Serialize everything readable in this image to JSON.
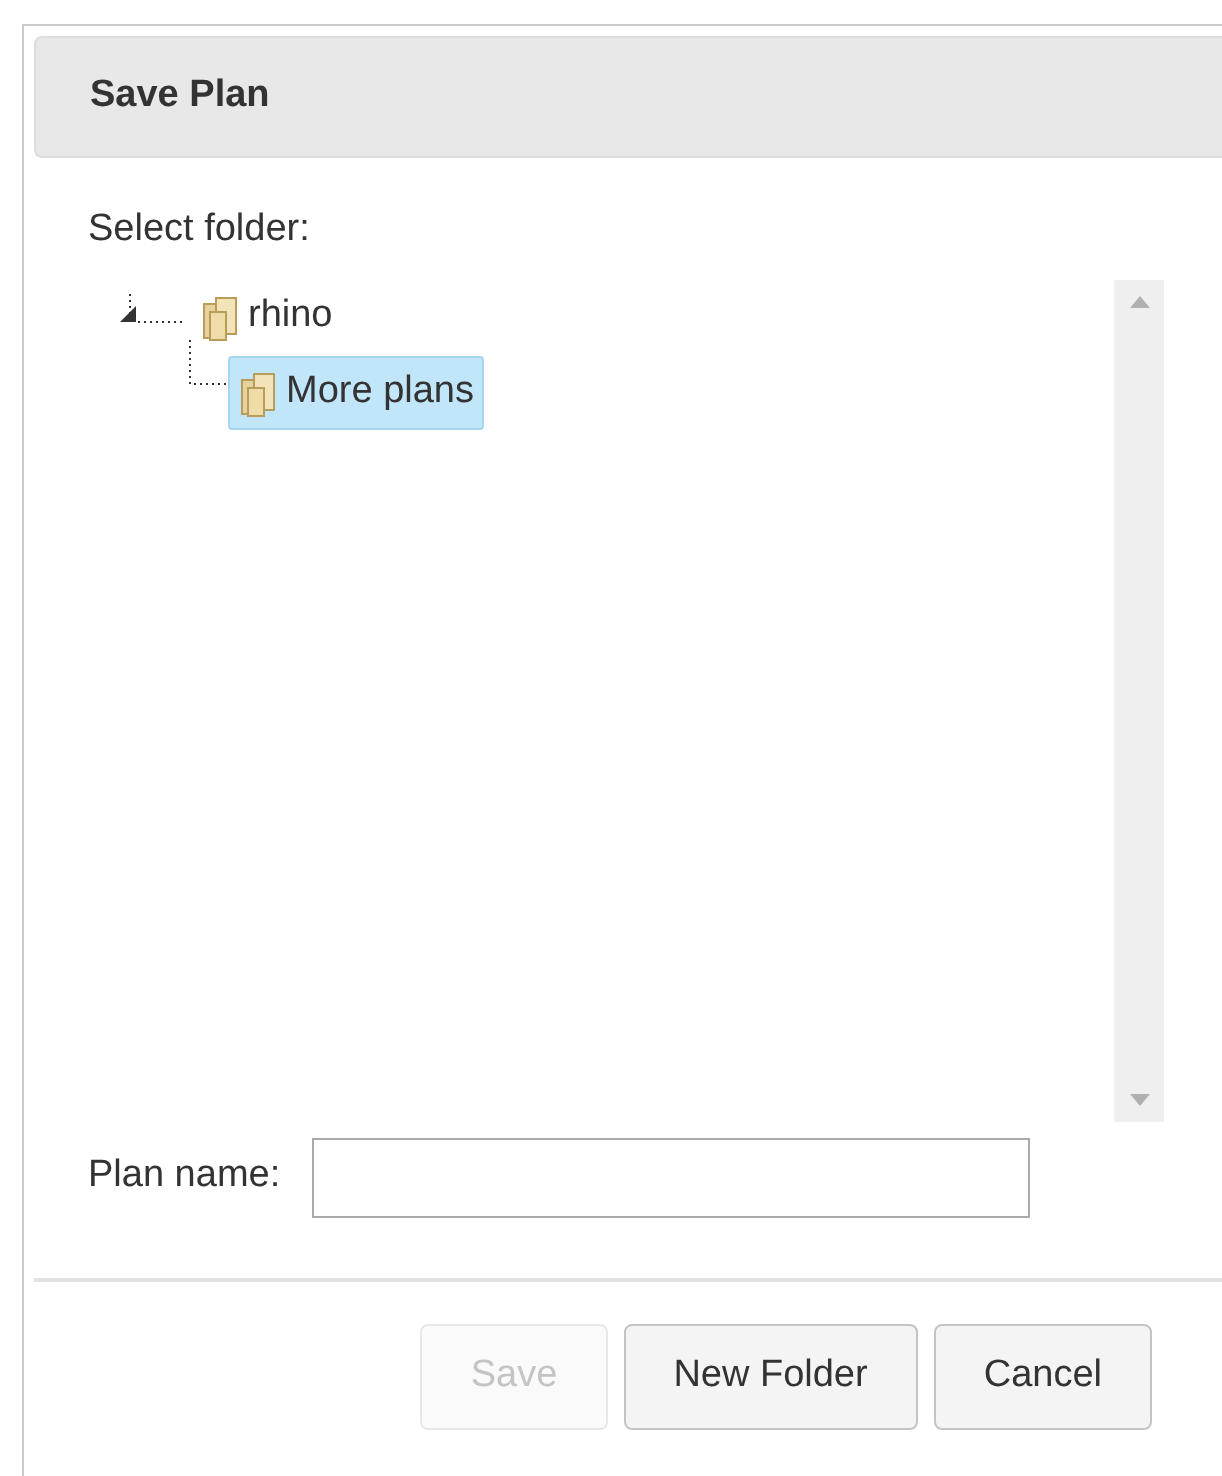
{
  "dialog": {
    "title": "Save Plan"
  },
  "folder_label": "Select folder:",
  "tree": [
    {
      "label": "rhino",
      "expanded": true,
      "selected": false,
      "children": [
        {
          "label": "More plans",
          "selected": true
        }
      ]
    }
  ],
  "plan_name": {
    "label": "Plan name:"
  },
  "buttons": [
    {
      "label": "Save",
      "disabled": true
    },
    {
      "label": "New Folder",
      "disabled": false
    },
    {
      "label": "Cancel",
      "disabled": false
    }
  ]
}
